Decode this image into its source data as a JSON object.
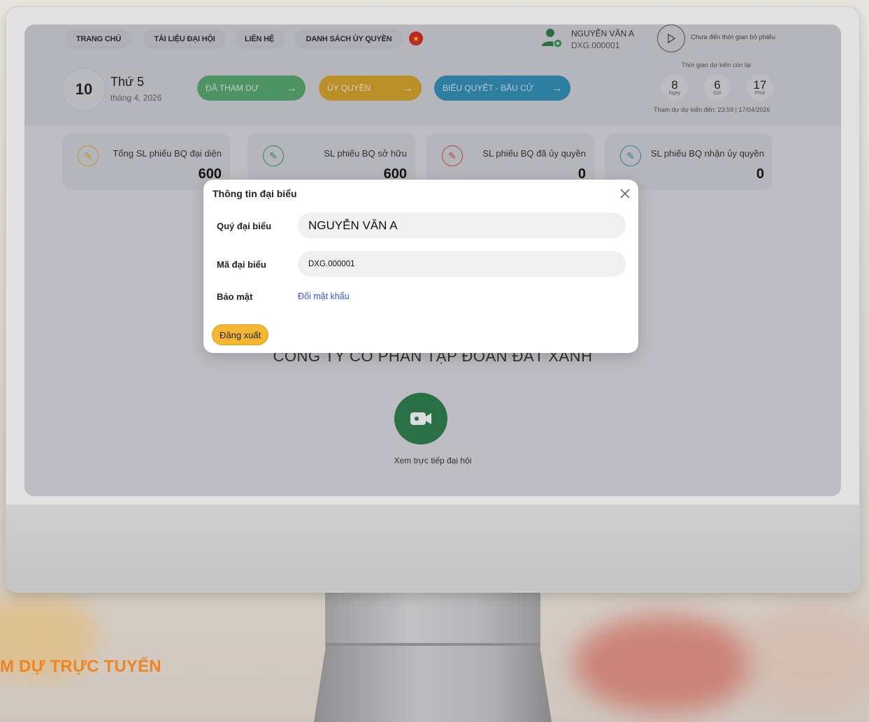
{
  "nav": {
    "home": "TRANG CHỦ",
    "documents": "TÀI LIỆU ĐẠI HỘI",
    "contact": "LIÊN HỆ",
    "proxy_list": "DANH SÁCH ỦY QUYỀN"
  },
  "user": {
    "name": "NGUYỄN VĂN A",
    "code": "DXG.000001"
  },
  "vote_status": "Chưa đến thời gian bỏ phiếu",
  "date": {
    "day": "10",
    "weekday": "Thứ 5",
    "month_year": "tháng 4, 2026"
  },
  "actions": {
    "attended": "ĐÃ THAM DỰ",
    "proxy": "ỦY QUYỀN",
    "vote": "BIỂU QUYẾT - BẦU CỬ"
  },
  "countdown": {
    "caption": "Thời gian dự kiến còn lại",
    "days": "8",
    "days_unit": "Ngày",
    "hours": "6",
    "hours_unit": "Giờ",
    "minutes": "17",
    "minutes_unit": "Phút",
    "deadline": "Tham dự dự kiến đến: 23:59 | 17/04/2026"
  },
  "stats": [
    {
      "label": "Tổng SL phiếu BQ đại diện",
      "value": "600"
    },
    {
      "label": "SL phiếu BQ sở hữu",
      "value": "600"
    },
    {
      "label": "SL phiếu BQ đã ủy quyền",
      "value": "0"
    },
    {
      "label": "SL phiếu BQ nhận ủy quyền",
      "value": "0"
    }
  ],
  "company": "CÔNG TY CỔ PHẦN TẬP ĐOÀN ĐẤT XANH",
  "live_label": "Xem trực tiếp đại hội",
  "modal": {
    "title": "Thông tin đại biểu",
    "name_label": "Quý đại biểu",
    "name_value": "NGUYỄN VĂN A",
    "code_label": "Mã đại biểu",
    "code_value": "DXG.000001",
    "security_label": "Bảo mật",
    "change_password": "Đổi mật khẩu",
    "logout": "Đăng xuất"
  },
  "footer_text": "M DỰ TRỰC TUYẾN",
  "colors": {
    "attended": "#55a86d",
    "proxy": "#d7a424",
    "vote": "#2f8fb6",
    "logout": "#f5b731",
    "link": "#3056d3",
    "footer": "#f0841e",
    "live": "#2a7f4a"
  }
}
